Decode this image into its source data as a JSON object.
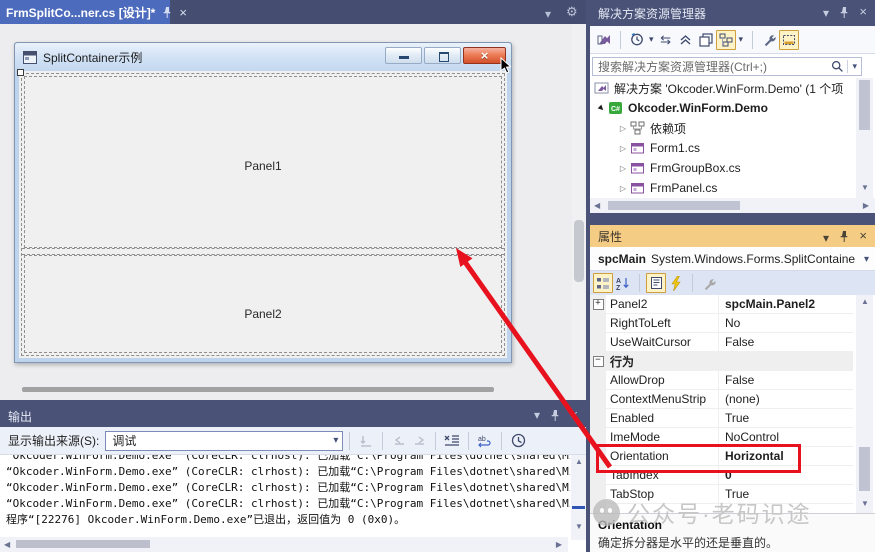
{
  "colors": {
    "annotation_red": "#e8121f",
    "active_tab_blue": "#4d6bbd",
    "environment": "#4a5377",
    "active_toolwindow_gold": "#f5cc84"
  },
  "window": {
    "tab_title": "FrmSplitCo...ner.cs [设计]*"
  },
  "designer": {
    "form_title": "SplitContainer示例",
    "panel1_label": "Panel1",
    "panel2_label": "Panel2"
  },
  "output": {
    "title": "输出",
    "source_label": "显示输出来源(S):",
    "source_value": "调试",
    "lines": [
      "“Okcoder.WinForm.Demo.exe” (CoreCLR: clrhost): 已加载“C:\\Program Files\\dotnet\\shared\\Micr",
      "“Okcoder.WinForm.Demo.exe” (CoreCLR: clrhost): 已加载“C:\\Program Files\\dotnet\\shared\\Micr",
      "“Okcoder.WinForm.Demo.exe” (CoreCLR: clrhost): 已加载“C:\\Program Files\\dotnet\\shared\\Micr",
      "“Okcoder.WinForm.Demo.exe” (CoreCLR: clrhost): 已加载“C:\\Program Files\\dotnet\\shared\\Micr",
      "程序“[22276] Okcoder.WinForm.Demo.exe”已退出，返回值为 0 (0x0)。"
    ]
  },
  "solution_explorer": {
    "title": "解决方案资源管理器",
    "search_placeholder": "搜索解决方案资源管理器(Ctrl+;)",
    "items": [
      {
        "icon": "solution",
        "label": "解决方案 'Okcoder.WinForm.Demo' (1 个项",
        "indent": 4,
        "chevron": "none",
        "bold": false
      },
      {
        "icon": "csproj",
        "label": "Okcoder.WinForm.Demo",
        "indent": 4,
        "chevron": "expanded",
        "bold": true
      },
      {
        "icon": "deps",
        "label": "依赖项",
        "indent": 26,
        "chevron": "collapsed",
        "bold": false
      },
      {
        "icon": "form",
        "label": "Form1.cs",
        "indent": 26,
        "chevron": "collapsed",
        "bold": false
      },
      {
        "icon": "form",
        "label": "FrmGroupBox.cs",
        "indent": 26,
        "chevron": "collapsed",
        "bold": false
      },
      {
        "icon": "form",
        "label": "FrmPanel.cs",
        "indent": 26,
        "chevron": "collapsed",
        "bold": false
      }
    ]
  },
  "properties": {
    "title": "属性",
    "object_name": "spcMain",
    "object_type": "System.Windows.Forms.SplitContaine",
    "rows": [
      {
        "expander": "+",
        "name": "Panel2",
        "value": "spcMain.Panel2",
        "value_bold": true
      },
      {
        "name": "RightToLeft",
        "value": "No"
      },
      {
        "name": "UseWaitCursor",
        "value": "False"
      },
      {
        "type": "category",
        "expander": "-",
        "name": "行为",
        "value": ""
      },
      {
        "name": "AllowDrop",
        "value": "False"
      },
      {
        "name": "ContextMenuStrip",
        "value": "(none)"
      },
      {
        "name": "Enabled",
        "value": "True"
      },
      {
        "name": "ImeMode",
        "value": "NoControl"
      },
      {
        "name": "Orientation",
        "value": "Horizontal",
        "value_bold": true,
        "highlighted": true
      },
      {
        "name": "TabIndex",
        "value": "0",
        "value_bold": true
      },
      {
        "name": "TabStop",
        "value": "True"
      },
      {
        "name": "",
        "value": ""
      }
    ],
    "description_title": "Orientation",
    "description_text": "确定拆分器是水平的还是垂直的。"
  },
  "watermark": {
    "text": "公众号·老码识途"
  }
}
